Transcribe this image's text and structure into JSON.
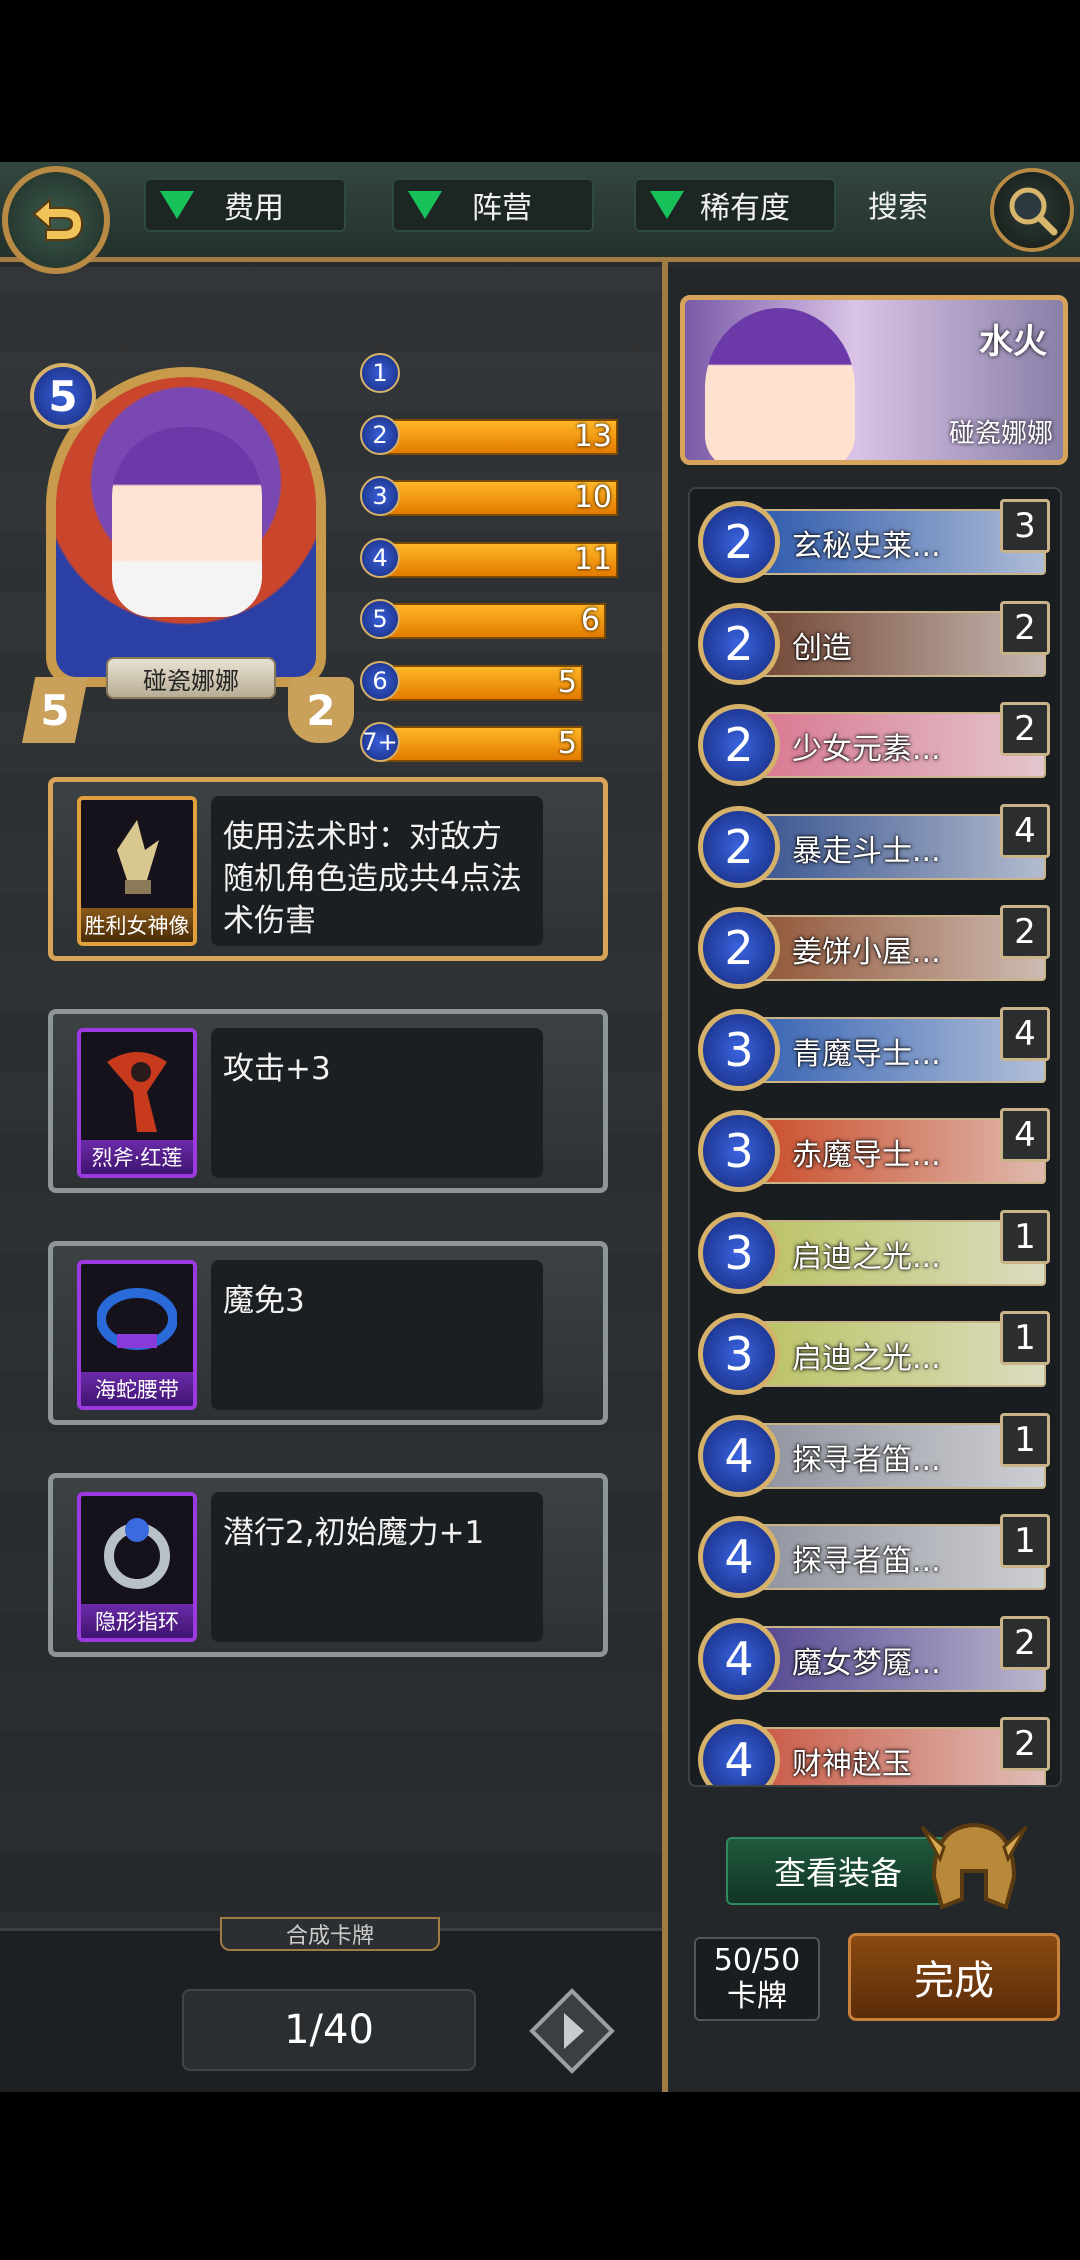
{
  "filters": {
    "cost": "费用",
    "faction": "阵营",
    "rarity": "稀有度",
    "search": "搜索"
  },
  "hero": {
    "name": "碰瓷娜娜",
    "cost": "5",
    "attack": "5",
    "health": "2"
  },
  "mana_curve": [
    {
      "cost": "1",
      "count": "",
      "fill": 0
    },
    {
      "cost": "2",
      "count": "13",
      "fill": 1.0
    },
    {
      "cost": "3",
      "count": "10",
      "fill": 1.0
    },
    {
      "cost": "4",
      "count": "11",
      "fill": 1.0
    },
    {
      "cost": "5",
      "count": "6",
      "fill": 0.95
    },
    {
      "cost": "6",
      "count": "5",
      "fill": 0.85
    },
    {
      "cost": "7+",
      "count": "5",
      "fill": 0.85
    }
  ],
  "equipment": [
    {
      "name": "胜利女神像",
      "desc": "使用法术时：对敌方随机角色造成共4点法术伤害",
      "rarity": "legendary"
    },
    {
      "name": "烈斧·红莲",
      "desc": "攻击+3",
      "rarity": "epic"
    },
    {
      "name": "海蛇腰带",
      "desc": "魔免3",
      "rarity": "epic"
    },
    {
      "name": "隐形指环",
      "desc": "潜行2,初始魔力+1",
      "rarity": "epic"
    }
  ],
  "bottom": {
    "merge_tab": "合成卡牌",
    "progress": "1/40"
  },
  "leader": {
    "element": "水火",
    "name": "碰瓷娜娜"
  },
  "deck_list": [
    {
      "cost": "2",
      "name": "玄秘史莱...",
      "count": "3",
      "color": "#1f4fa8"
    },
    {
      "cost": "2",
      "name": "创造",
      "count": "2",
      "color": "#6a3a26"
    },
    {
      "cost": "2",
      "name": "少女元素...",
      "count": "2",
      "color": "#d86f8a"
    },
    {
      "cost": "2",
      "name": "暴走斗士...",
      "count": "4",
      "color": "#2d4a8a"
    },
    {
      "cost": "2",
      "name": "姜饼小屋...",
      "count": "2",
      "color": "#8a4a2a"
    },
    {
      "cost": "3",
      "name": "青魔导士...",
      "count": "4",
      "color": "#2a5ab0"
    },
    {
      "cost": "3",
      "name": "赤魔导士...",
      "count": "4",
      "color": "#c8421c"
    },
    {
      "cost": "3",
      "name": "启迪之光...",
      "count": "1",
      "color": "#b8c05a"
    },
    {
      "cost": "3",
      "name": "启迪之光...",
      "count": "1",
      "color": "#b8c05a"
    },
    {
      "cost": "4",
      "name": "探寻者笛...",
      "count": "1",
      "color": "#8a8e9a"
    },
    {
      "cost": "4",
      "name": "探寻者笛...",
      "count": "1",
      "color": "#8a8e9a"
    },
    {
      "cost": "4",
      "name": "魔女梦魇...",
      "count": "2",
      "color": "#4a3a8a"
    },
    {
      "cost": "4",
      "name": "财神赵玉",
      "count": "2",
      "color": "#c8503a"
    }
  ],
  "actions": {
    "view_equipment": "查看装备",
    "deck_size": "50/50",
    "deck_label": "卡牌",
    "done": "完成"
  }
}
